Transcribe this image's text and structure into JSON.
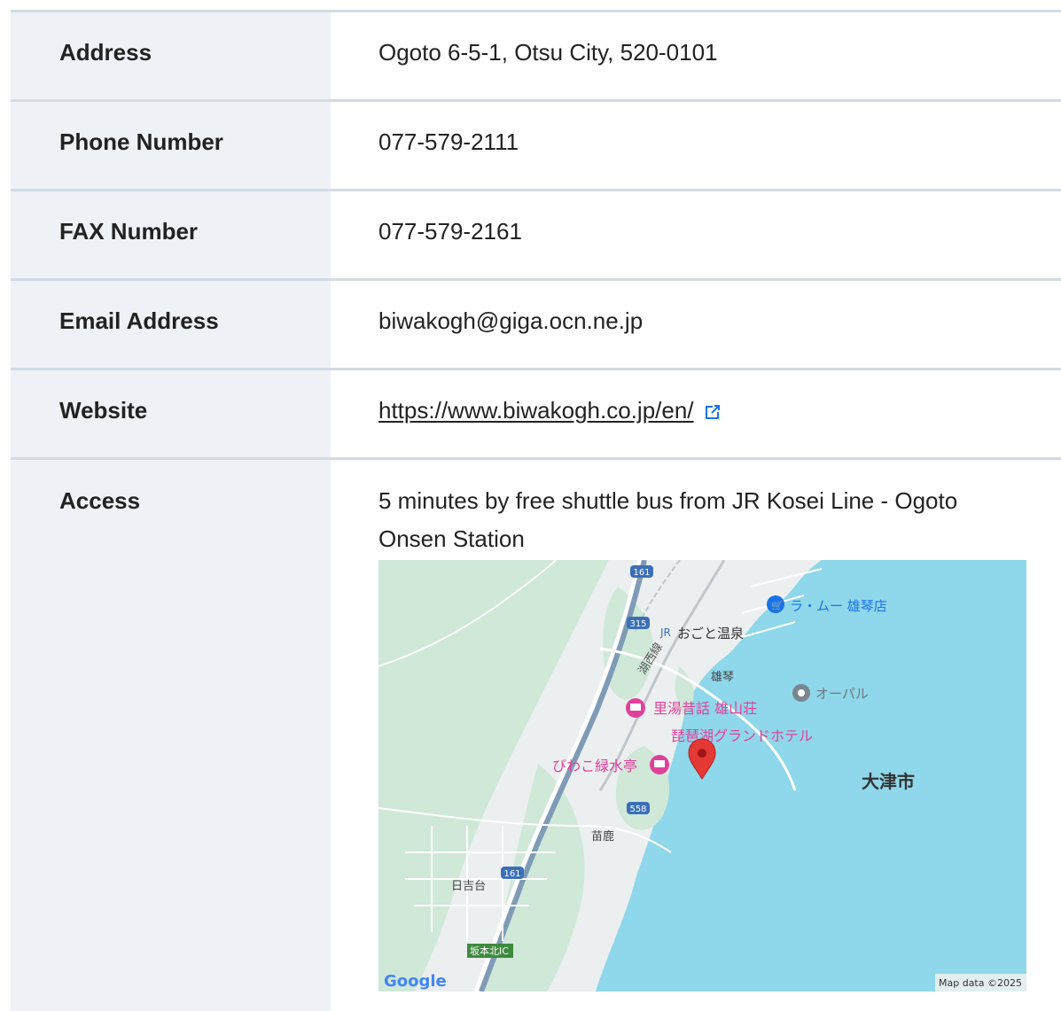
{
  "rows": [
    {
      "label": "Address",
      "value": "Ogoto 6-5-1, Otsu City, 520-0101"
    },
    {
      "label": "Phone Number",
      "value": "077-579-2111"
    },
    {
      "label": "FAX Number",
      "value": "077-579-2161"
    },
    {
      "label": "Email Address",
      "value": "biwakogh@giga.ocn.ne.jp"
    },
    {
      "label": "Website",
      "value": "https://www.biwakogh.co.jp/en/"
    },
    {
      "label": "Access",
      "value": "5 minutes by free shuttle bus from JR Kosei Line - Ogoto Onsen Station"
    }
  ],
  "map": {
    "places": {
      "station": "おごと温泉",
      "shop": "ラ・ムー 雄琴店",
      "area_ogoto": "雄琴",
      "opal": "オーパル",
      "hotel1": "里湯昔話 雄山荘",
      "hotel_target": "琵琶湖グランドホテル",
      "hotel2": "びわこ緑水亭",
      "city": "大津市",
      "area_noka": "苗鹿",
      "area_hiyoshidai": "日吉台",
      "ic": "坂本北IC",
      "rail_line": "湖西線"
    },
    "routes": {
      "r161a": "161",
      "r315": "315",
      "r558": "558",
      "r161b": "161"
    },
    "google_logo": "Google",
    "attribution": "Map data ©2025"
  },
  "colors": {
    "header_bg": "#eef2f6",
    "border": "#d3dbe3",
    "water": "#8fd7ea",
    "hotel_pink": "#e0409a",
    "pin_red": "#e53935"
  }
}
